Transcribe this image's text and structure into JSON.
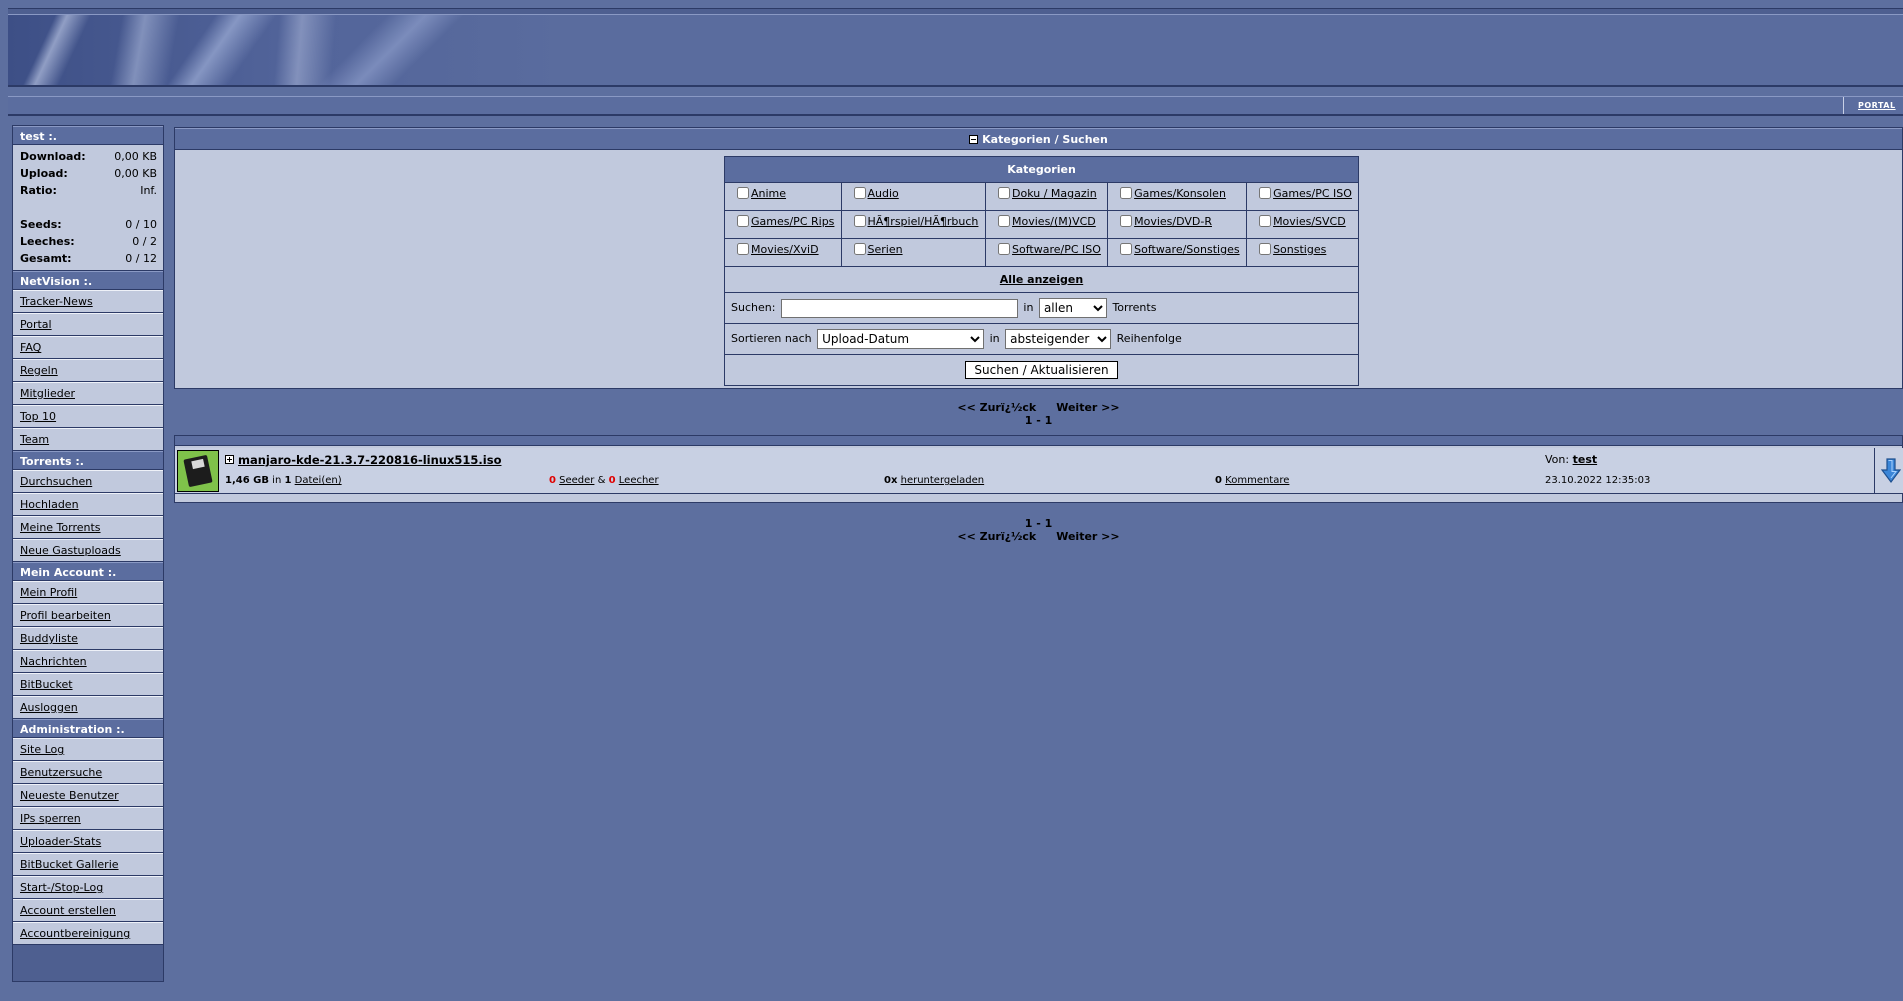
{
  "header": {
    "portal_tab": "PORTAL"
  },
  "sidebar": {
    "user_title": "test :.",
    "stats": [
      {
        "label": "Download:",
        "value": "0,00 KB"
      },
      {
        "label": "Upload:",
        "value": "0,00 KB"
      },
      {
        "label": "Ratio:",
        "value": "Inf."
      }
    ],
    "stats2": [
      {
        "label": "Seeds:",
        "value": "0 / 10"
      },
      {
        "label": "Leeches:",
        "value": "0 / 2"
      },
      {
        "label": "Gesamt:",
        "value": "0 / 12"
      }
    ],
    "netvision_title": "NetVision :.",
    "netvision_items": [
      "Tracker-News",
      "Portal",
      "FAQ",
      "Regeln",
      "Mitglieder",
      "Top 10",
      "Team"
    ],
    "torrents_title": "Torrents :.",
    "torrents_items": [
      "Durchsuchen",
      "Hochladen",
      "Meine Torrents",
      "Neue Gastuploads"
    ],
    "account_title": "Mein Account :.",
    "account_items": [
      "Mein Profil",
      "Profil bearbeiten",
      "Buddyliste",
      "Nachrichten",
      "BitBucket",
      "Ausloggen"
    ],
    "admin_title": "Administration :.",
    "admin_items": [
      "Site Log",
      "Benutzersuche",
      "Neueste Benutzer",
      "IPs sperren",
      "Uploader-Stats",
      "BitBucket Gallerie",
      "Start-/Stop-Log",
      "Account erstellen",
      "Accountbereinigung"
    ]
  },
  "search": {
    "panel_title": "Kategorien / Suchen",
    "categories_title": "Kategorien",
    "categories": [
      [
        "Anime",
        "Audio",
        "Doku / Magazin",
        "Games/Konsolen",
        "Games/PC ISO"
      ],
      [
        "Games/PC Rips",
        "HÃ¶rspiel/HÃ¶rbuch",
        "Movies/(M)VCD",
        "Movies/DVD-R",
        "Movies/SVCD"
      ],
      [
        "Movies/XviD",
        "Serien",
        "Software/PC ISO",
        "Software/Sonstiges",
        "Sonstiges"
      ]
    ],
    "show_all": "Alle anzeigen",
    "search_label": "Suchen:",
    "search_value": "",
    "in_label": "in",
    "scope_selected": "allen",
    "torrents_label": "Torrents",
    "sort_label": "Sortieren nach",
    "sort_selected": "Upload-Datum",
    "order_selected": "absteigender",
    "order_suffix": "Reihenfolge",
    "submit_label": "Suchen / Aktualisieren"
  },
  "pagination": {
    "prev": "<< Zurï¿½ck",
    "next": "Weiter >>",
    "range": "1 - 1"
  },
  "torrents": [
    {
      "name": "manjaro-kde-21.3.7-220816-linux515.iso",
      "size": "1,46 GB",
      "in_text": "in",
      "files": "1",
      "files_label": "Datei(en)",
      "seeders": "0",
      "seeder_label": "Seeder",
      "amp": "&",
      "leechers": "0",
      "leecher_label": "Leecher",
      "downloaded": "0x",
      "downloaded_label": "heruntergeladen",
      "comments": "0",
      "comments_label": "Kommentare",
      "uploader_label": "Von:",
      "uploader": "test",
      "date": "23.10.2022 12:35:03"
    }
  ],
  "colors": {
    "background": "#5d6f9f",
    "panel": "#c1c9dd",
    "header": "#5b6d9f",
    "border": "#2c3a66",
    "counter_red": "#e00000"
  }
}
